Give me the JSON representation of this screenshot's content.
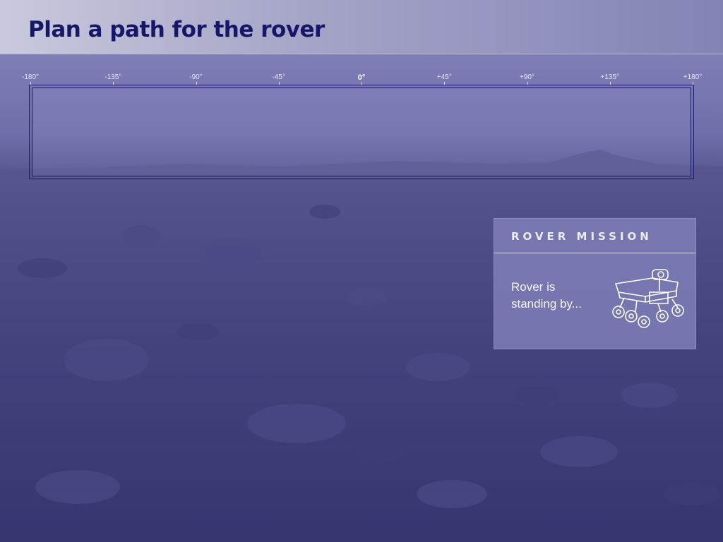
{
  "header": {
    "title": "Plan a path for the rover"
  },
  "panorama": {
    "ticks": [
      "-180°",
      "-135°",
      "-90°",
      "-45°",
      "0°",
      "+45°",
      "+90°",
      "+135°",
      "+180°"
    ]
  },
  "mission_panel": {
    "title": "ROVER MISSION",
    "status": "Rover is standing by...",
    "icon": "rover-icon"
  },
  "colors": {
    "title": "#17176a",
    "background": "#3a3a78",
    "panel": "#8080ba",
    "frame": "#1c1c6c"
  }
}
